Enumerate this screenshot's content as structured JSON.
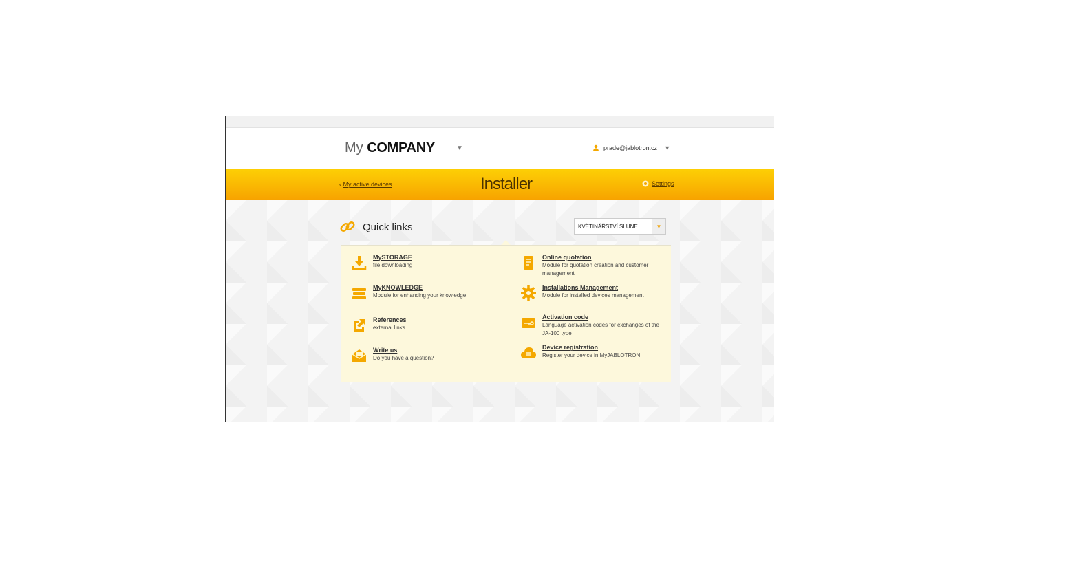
{
  "header": {
    "logo_my": "My",
    "logo_company": "COMPANY",
    "user_email": "prade@jablotron.cz"
  },
  "bar": {
    "back_link": "My active devices",
    "title": "Installer",
    "settings": "Settings"
  },
  "quick_links": {
    "title": "Quick links",
    "device_select": "KVĚTINÁŘSTVÍ SLUNE...",
    "items": [
      {
        "label": "MySTORAGE",
        "desc": "file downloading",
        "icon": "download-icon"
      },
      {
        "label": "Online quotation",
        "desc": "Module for quotation creation and customer management",
        "icon": "document-icon"
      },
      {
        "label": "MyKNOWLEDGE",
        "desc": "Module for enhancing your knowledge",
        "icon": "books-icon"
      },
      {
        "label": "Installations Management",
        "desc": "Module for installed devices management",
        "icon": "gear-icon"
      },
      {
        "label": "References",
        "desc": "external links",
        "icon": "external-link-icon"
      },
      {
        "label": "Activation code",
        "desc": "Language activation codes for exchanges of the JA-100 type",
        "icon": "key-icon"
      },
      {
        "label": "Write us",
        "desc": "Do you have a question?",
        "icon": "mail-icon"
      },
      {
        "label": "Device registration",
        "desc": "Register your device in MyJABLOTRON",
        "icon": "cloud-icon"
      }
    ]
  },
  "colors": {
    "accent": "#f7a300",
    "accent_light": "#fdcf05",
    "panel_bg": "#fdf8dc"
  }
}
